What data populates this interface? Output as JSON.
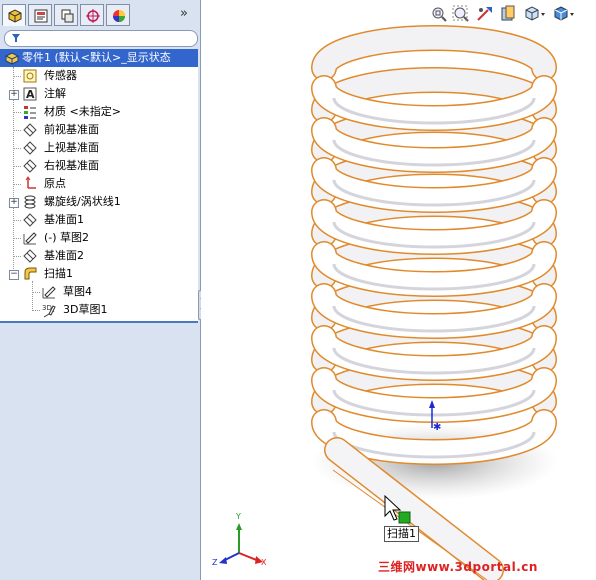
{
  "feature_tree": {
    "root_label": "零件1   (默认<默认>_显示状态",
    "items": [
      {
        "label": "传感器"
      },
      {
        "label": "注解"
      },
      {
        "label": "材质 <未指定>"
      },
      {
        "label": "前视基准面"
      },
      {
        "label": "上视基准面"
      },
      {
        "label": "右视基准面"
      },
      {
        "label": "原点"
      },
      {
        "label": "螺旋线/涡状线1"
      },
      {
        "label": "基准面1"
      },
      {
        "label": "(-) 草图2"
      },
      {
        "label": "基准面2"
      },
      {
        "label": "扫描1"
      },
      {
        "label": "草图4"
      },
      {
        "label": "3D草图1"
      }
    ]
  },
  "panel": {
    "expand_glyph": "»"
  },
  "icons": {
    "tabs": [
      "feature-manager-icon",
      "property-manager-icon",
      "configuration-manager-icon",
      "dim-xpert-icon",
      "display-manager-icon"
    ],
    "view_toolbar": [
      "zoom-to-fit-icon",
      "zoom-to-area-icon",
      "previous-view-icon",
      "section-view-icon",
      "view-orientation-icon",
      "display-style-icon"
    ]
  },
  "viewport": {
    "tooltip": "扫描1",
    "triad": {
      "y": "Y",
      "x": "X",
      "z": "Z"
    }
  },
  "watermark": "三维网www.3dportal.cn",
  "colors": {
    "selection": "#3366cc",
    "edge_highlight": "#e08a2c",
    "panel_bg": "#d8e2f0",
    "handle_green": "#22aa22"
  }
}
